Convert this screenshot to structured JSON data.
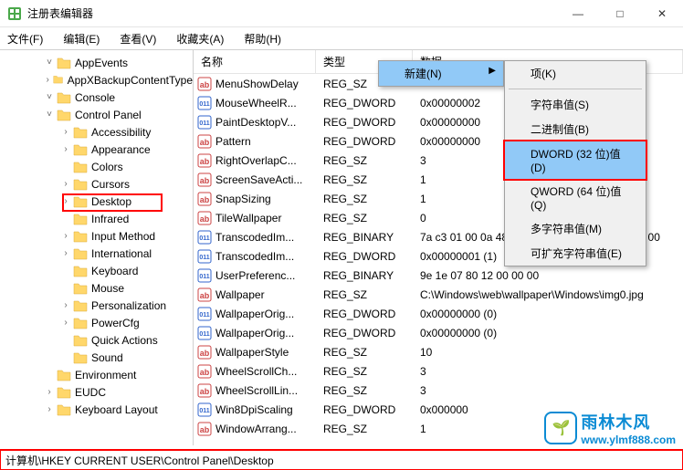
{
  "title": "注册表编辑器",
  "window_controls": {
    "min": "—",
    "max": "□",
    "close": "✕"
  },
  "menubar": [
    "文件(F)",
    "编辑(E)",
    "查看(V)",
    "收藏夹(A)",
    "帮助(H)"
  ],
  "tree": [
    {
      "indent": 48,
      "exp": "˅",
      "label": "AppEvents"
    },
    {
      "indent": 48,
      "exp": "›",
      "label": "AppXBackupContentType"
    },
    {
      "indent": 48,
      "exp": "˅",
      "label": "Console"
    },
    {
      "indent": 48,
      "exp": "˅",
      "label": "Control Panel"
    },
    {
      "indent": 66,
      "exp": "›",
      "label": "Accessibility"
    },
    {
      "indent": 66,
      "exp": "›",
      "label": "Appearance"
    },
    {
      "indent": 66,
      "exp": "",
      "label": "Colors"
    },
    {
      "indent": 66,
      "exp": "›",
      "label": "Cursors"
    },
    {
      "indent": 66,
      "exp": "›",
      "label": "Desktop",
      "selected": true
    },
    {
      "indent": 66,
      "exp": "",
      "label": "Infrared"
    },
    {
      "indent": 66,
      "exp": "›",
      "label": "Input Method"
    },
    {
      "indent": 66,
      "exp": "›",
      "label": "International"
    },
    {
      "indent": 66,
      "exp": "",
      "label": "Keyboard"
    },
    {
      "indent": 66,
      "exp": "",
      "label": "Mouse"
    },
    {
      "indent": 66,
      "exp": "›",
      "label": "Personalization"
    },
    {
      "indent": 66,
      "exp": "›",
      "label": "PowerCfg"
    },
    {
      "indent": 66,
      "exp": "",
      "label": "Quick Actions"
    },
    {
      "indent": 66,
      "exp": "",
      "label": "Sound"
    },
    {
      "indent": 48,
      "exp": "",
      "label": "Environment"
    },
    {
      "indent": 48,
      "exp": "›",
      "label": "EUDC"
    },
    {
      "indent": 48,
      "exp": "›",
      "label": "Keyboard Layout"
    }
  ],
  "columns": {
    "name": "名称",
    "type": "类型",
    "data": "数据"
  },
  "rows": [
    {
      "icon": "sz",
      "name": "MenuShowDelay",
      "type": "REG_SZ",
      "data": ""
    },
    {
      "icon": "dw",
      "name": "MouseWheelR...",
      "type": "REG_DWORD",
      "data": "0x00000002"
    },
    {
      "icon": "dw",
      "name": "PaintDesktopV...",
      "type": "REG_DWORD",
      "data": "0x00000000"
    },
    {
      "icon": "sz",
      "name": "Pattern",
      "type": "REG_DWORD",
      "data": "0x00000000"
    },
    {
      "icon": "sz",
      "name": "RightOverlapC...",
      "type": "REG_SZ",
      "data": "3"
    },
    {
      "icon": "sz",
      "name": "ScreenSaveActi...",
      "type": "REG_SZ",
      "data": "1"
    },
    {
      "icon": "sz",
      "name": "SnapSizing",
      "type": "REG_SZ",
      "data": "1"
    },
    {
      "icon": "sz",
      "name": "TileWallpaper",
      "type": "REG_SZ",
      "data": "0"
    },
    {
      "icon": "dw",
      "name": "TranscodedIm...",
      "type": "REG_BINARY",
      "data": "7a c3 01 00 0a 48 01 00 00 00 04 00 00 00 03 00"
    },
    {
      "icon": "dw",
      "name": "TranscodedIm...",
      "type": "REG_DWORD",
      "data": "0x00000001 (1)"
    },
    {
      "icon": "dw",
      "name": "UserPreferenc...",
      "type": "REG_BINARY",
      "data": "9e 1e 07 80 12 00 00 00"
    },
    {
      "icon": "sz",
      "name": "Wallpaper",
      "type": "REG_SZ",
      "data": "C:\\Windows\\web\\wallpaper\\Windows\\img0.jpg"
    },
    {
      "icon": "dw",
      "name": "WallpaperOrig...",
      "type": "REG_DWORD",
      "data": "0x00000000 (0)"
    },
    {
      "icon": "dw",
      "name": "WallpaperOrig...",
      "type": "REG_DWORD",
      "data": "0x00000000 (0)"
    },
    {
      "icon": "sz",
      "name": "WallpaperStyle",
      "type": "REG_SZ",
      "data": "10"
    },
    {
      "icon": "sz",
      "name": "WheelScrollCh...",
      "type": "REG_SZ",
      "data": "3"
    },
    {
      "icon": "sz",
      "name": "WheelScrollLin...",
      "type": "REG_SZ",
      "data": "3"
    },
    {
      "icon": "dw",
      "name": "Win8DpiScaling",
      "type": "REG_DWORD",
      "data": "0x000000"
    },
    {
      "icon": "sz",
      "name": "WindowArrang...",
      "type": "REG_SZ",
      "data": "1"
    }
  ],
  "context_main": {
    "label": "新建(N)"
  },
  "context_sub": [
    {
      "label": "项(K)"
    },
    {
      "sep": true
    },
    {
      "label": "字符串值(S)"
    },
    {
      "label": "二进制值(B)"
    },
    {
      "label": "DWORD (32 位)值(D)",
      "hl": true
    },
    {
      "label": "QWORD (64 位)值(Q)"
    },
    {
      "label": "多字符串值(M)"
    },
    {
      "label": "可扩充字符串值(E)"
    }
  ],
  "statusbar": "计算机\\HKEY CURRENT USER\\Control Panel\\Desktop",
  "watermark": {
    "cn": "雨林木风",
    "url": "www.ylmf888.com",
    "leaf": "🌱"
  }
}
